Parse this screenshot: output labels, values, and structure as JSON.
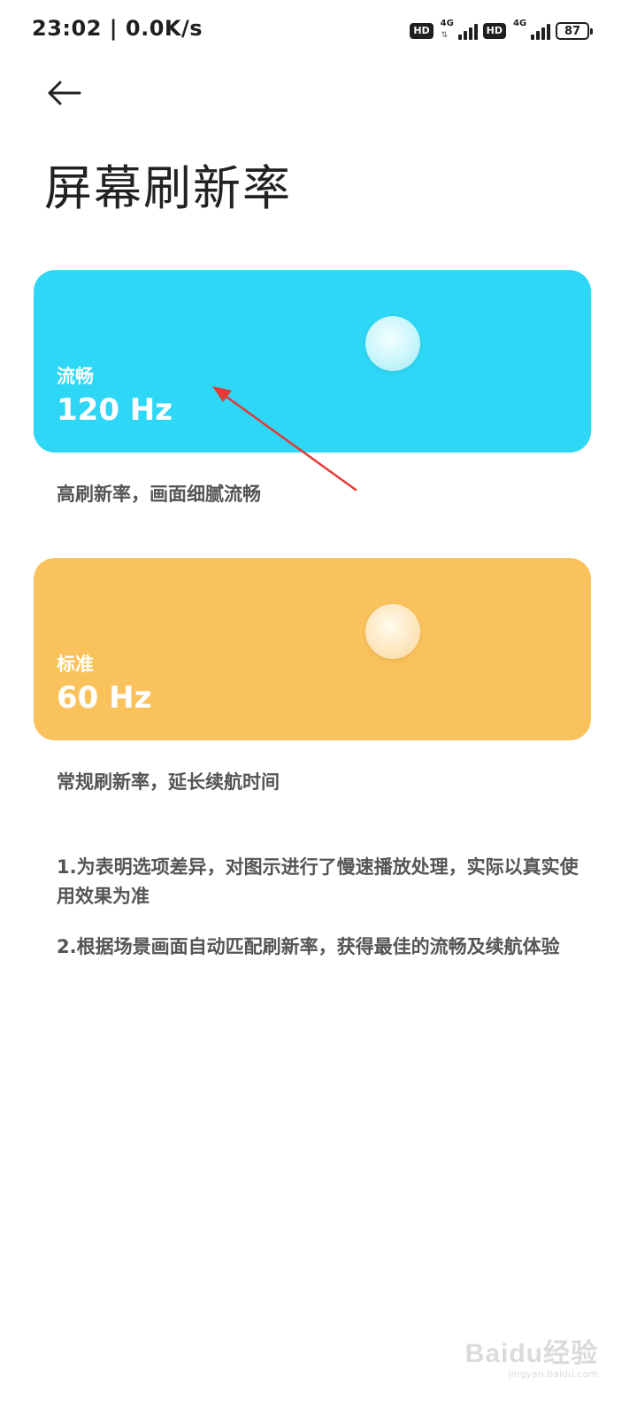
{
  "status_bar": {
    "time": "23:02 | 0.0K/s",
    "sim1": {
      "badge": "HD",
      "network": "4G"
    },
    "sim2": {
      "badge": "HD",
      "network": "4G"
    },
    "battery": "87"
  },
  "header": {
    "title": "屏幕刷新率"
  },
  "modes": [
    {
      "name": "流畅",
      "rate": "120 Hz",
      "description": "高刷新率，画面细腻流畅",
      "color": "#2ed7f5"
    },
    {
      "name": "标准",
      "rate": "60 Hz",
      "description": "常规刷新率，延长续航时间",
      "color": "#fac25c"
    }
  ],
  "notes": [
    "1.为表明选项差异，对图示进行了慢速播放处理，实际以真实使用效果为准",
    "2.根据场景画面自动匹配刷新率，获得最佳的流畅及续航体验"
  ],
  "watermark": {
    "logo": "Baidu经验",
    "url": "jingyan.baidu.com"
  },
  "annotation_color": "#e53935",
  "icons": {
    "back": "arrow-left-icon",
    "battery": "battery-icon",
    "signal": "signal-icon"
  }
}
